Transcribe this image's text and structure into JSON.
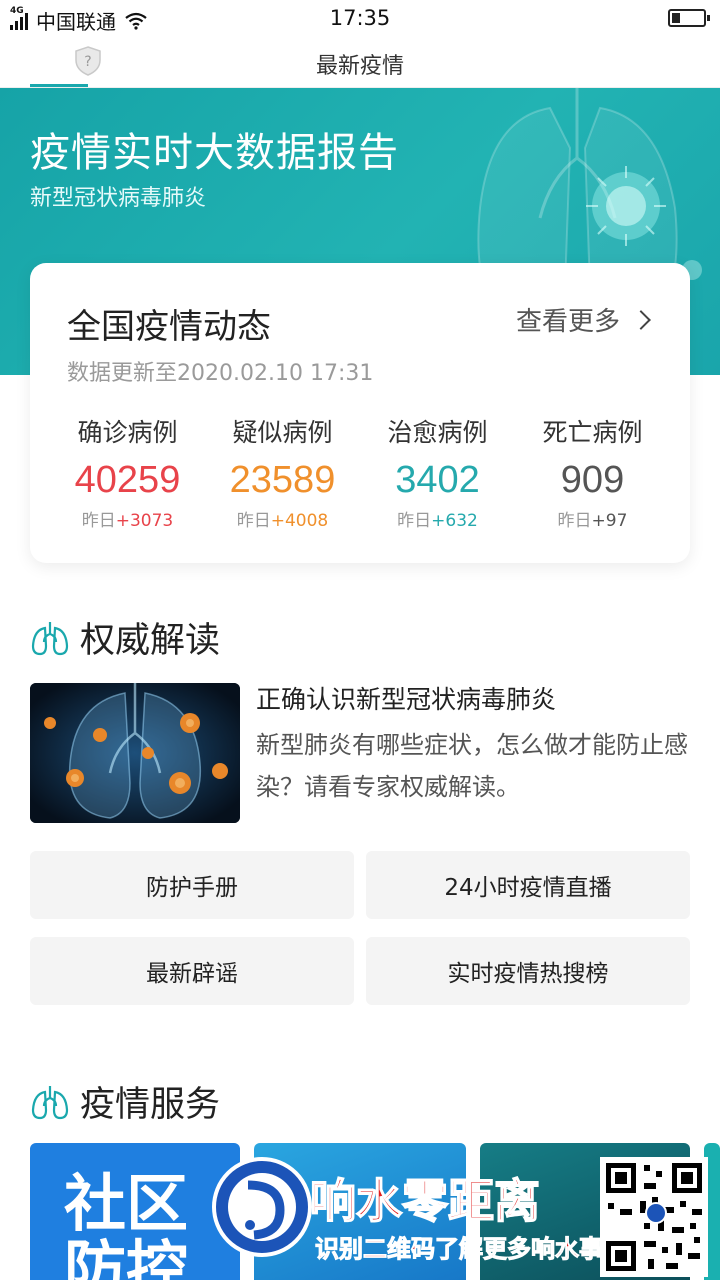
{
  "status_bar": {
    "network": "4G",
    "carrier": "中国联通",
    "time": "17:35"
  },
  "top_nav": {
    "title": "最新疫情"
  },
  "banner": {
    "title": "疫情实时大数据报告",
    "subtitle": "新型冠状病毒肺炎"
  },
  "national": {
    "title": "全国疫情动态",
    "more_label": "查看更多",
    "updated": "数据更新至2020.02.10 17:31",
    "stats": [
      {
        "label": "确诊病例",
        "value": "40259",
        "yesterday": "昨日",
        "delta": "+3073",
        "color": "#e8434a"
      },
      {
        "label": "疑似病例",
        "value": "23589",
        "yesterday": "昨日",
        "delta": "+4008",
        "color": "#f0902c"
      },
      {
        "label": "治愈病例",
        "value": "3402",
        "yesterday": "昨日",
        "delta": "+632",
        "color": "#25a9ad"
      },
      {
        "label": "死亡病例",
        "value": "909",
        "yesterday": "昨日",
        "delta": "+97",
        "color": "#555555"
      }
    ]
  },
  "authority": {
    "heading": "权威解读",
    "article": {
      "title": "正确认识新型冠状病毒肺炎",
      "desc": "新型肺炎有哪些症状，怎么做才能防止感染？请看专家权威解读。"
    },
    "buttons": [
      "防护手册",
      "24小时疫情直播",
      "最新辟谣",
      "实时疫情热搜榜"
    ]
  },
  "services": {
    "heading": "疫情服务",
    "tiles": [
      {
        "text": "社区防控",
        "color": "#1f7fe0"
      },
      {
        "text": "",
        "color": "#1a9ad8"
      },
      {
        "text": "",
        "color": "#0f6a78"
      }
    ]
  },
  "watermark": {
    "name": "响水零距离",
    "tagline": "识别二维码了解更多响水事"
  }
}
